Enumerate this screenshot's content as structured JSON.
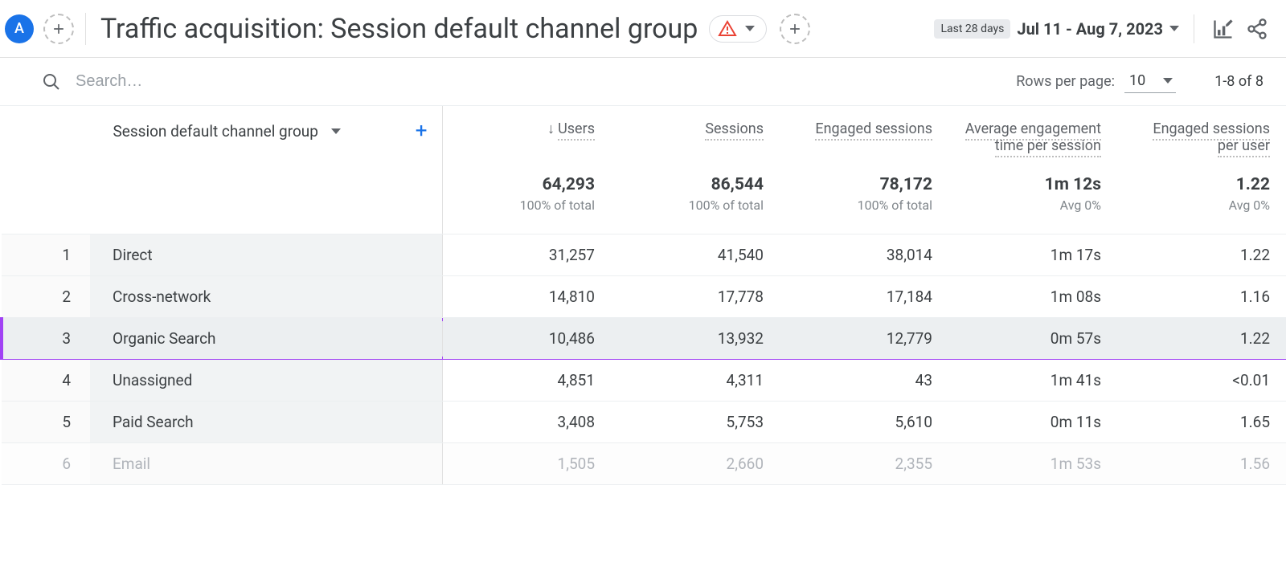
{
  "header": {
    "avatar_letter": "A",
    "title": "Traffic acquisition: Session default channel group",
    "date_badge": "Last 28 days",
    "date_range": "Jul 11 - Aug 7, 2023"
  },
  "toolbar": {
    "search_placeholder": "Search…",
    "rows_per_page_label": "Rows per page:",
    "rows_per_page_value": "10",
    "page_info": "1-8 of 8"
  },
  "table": {
    "dimension_label": "Session default channel group",
    "columns": [
      {
        "label": "Users",
        "sorted_desc": true
      },
      {
        "label": "Sessions"
      },
      {
        "label": "Engaged sessions"
      },
      {
        "label": "Average engagement time per session"
      },
      {
        "label": "Engaged sessions per user"
      }
    ],
    "totals": {
      "values": [
        "64,293",
        "86,544",
        "78,172",
        "1m 12s",
        "1.22"
      ],
      "subs": [
        "100% of total",
        "100% of total",
        "100% of total",
        "Avg 0%",
        "Avg 0%"
      ]
    },
    "rows": [
      {
        "n": "1",
        "dim": "Direct",
        "v": [
          "31,257",
          "41,540",
          "38,014",
          "1m 17s",
          "1.22"
        ],
        "hl": false
      },
      {
        "n": "2",
        "dim": "Cross-network",
        "v": [
          "14,810",
          "17,778",
          "17,184",
          "1m 08s",
          "1.16"
        ],
        "hl": false
      },
      {
        "n": "3",
        "dim": "Organic Search",
        "v": [
          "10,486",
          "13,932",
          "12,779",
          "0m 57s",
          "1.22"
        ],
        "hl": true
      },
      {
        "n": "4",
        "dim": "Unassigned",
        "v": [
          "4,851",
          "4,311",
          "43",
          "1m 41s",
          "<0.01"
        ],
        "hl": false
      },
      {
        "n": "5",
        "dim": "Paid Search",
        "v": [
          "3,408",
          "5,753",
          "5,610",
          "0m 11s",
          "1.65"
        ],
        "hl": false
      },
      {
        "n": "6",
        "dim": "Email",
        "v": [
          "1,505",
          "2,660",
          "2,355",
          "1m 53s",
          "1.56"
        ],
        "hl": false,
        "fade": true
      }
    ]
  }
}
